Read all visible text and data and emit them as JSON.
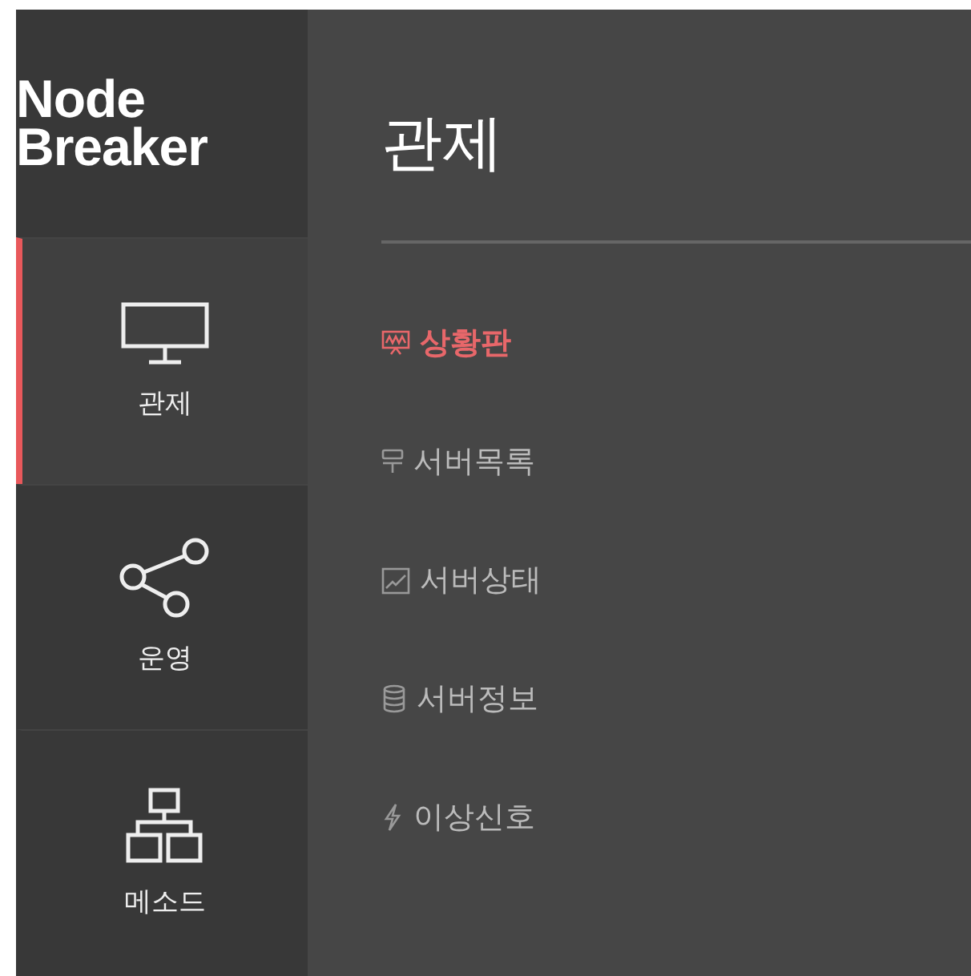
{
  "logo": {
    "line_1": "Node",
    "line_2": "Breaker"
  },
  "nav": [
    {
      "kind": "monitor",
      "label": "관제",
      "selected": true
    },
    {
      "kind": "share",
      "label": "운영",
      "selected": false
    },
    {
      "kind": "network",
      "label": "메소드",
      "selected": false
    }
  ],
  "page_title": "관제",
  "submenu": [
    {
      "kind": "dashboard",
      "label": "상황판",
      "selected": true
    },
    {
      "kind": "server",
      "label": "서버목록",
      "selected": false
    },
    {
      "kind": "chart",
      "label": "서버상태",
      "selected": false
    },
    {
      "kind": "database",
      "label": "서버정보",
      "selected": false
    },
    {
      "kind": "bolt",
      "label": "이상신호",
      "selected": false
    }
  ]
}
